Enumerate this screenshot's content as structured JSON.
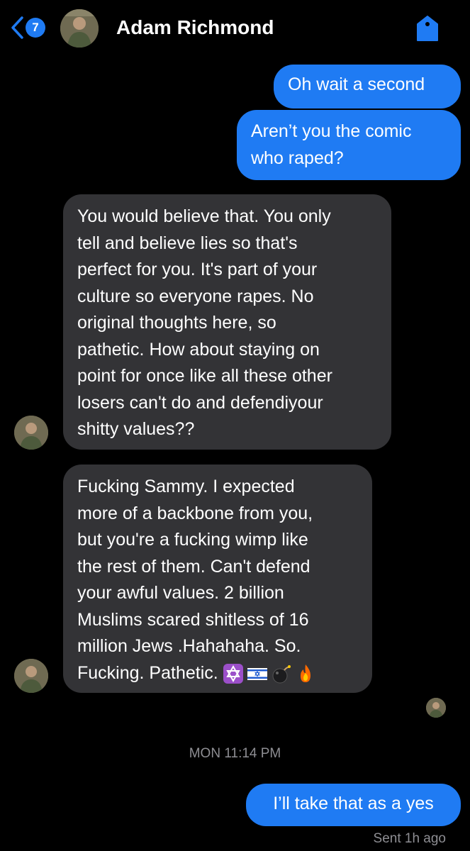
{
  "header": {
    "back_count": "7",
    "contact_name": "Adam Richmond",
    "back_icon": "chevron-left-icon",
    "tag_icon": "tag-icon",
    "accent": "#1f7bf3"
  },
  "messages": [
    {
      "direction": "outgoing",
      "lines": [
        "Oh wait a second"
      ]
    },
    {
      "direction": "outgoing",
      "lines": [
        "Aren’t you the comic",
        "who raped?"
      ]
    },
    {
      "direction": "incoming",
      "lines": [
        "You would believe that. You only",
        "tell and believe lies so that's",
        "perfect for you. It's part of your",
        "culture so everyone rapes. No",
        "original thoughts here, so",
        "pathetic. How about staying on",
        "point for once like all these other",
        "losers can't do and defendiyour",
        "shitty values??"
      ]
    },
    {
      "direction": "incoming",
      "lines": [
        "Fucking Sammy. I expected",
        "more of a backbone from you,",
        "but you're a fucking wimp like",
        "the rest of them. Can't defend",
        "your awful values. 2 billion",
        "Muslims scared shitless of 16",
        "million Jews .Hahahaha. So.",
        "Fucking. Pathetic."
      ],
      "emojis": [
        "star-of-david-emoji",
        "israel-flag-emoji",
        "bomb-emoji",
        "fire-emoji"
      ]
    },
    {
      "direction": "outgoing",
      "lines": [
        "I’ll take that as a yes"
      ]
    }
  ],
  "timestamp": "MON 11:14 PM",
  "sent_status": "Sent 1h ago",
  "colors": {
    "outgoing_bubble": "#1f7bf3",
    "incoming_bubble": "#333336",
    "meta_text": "#8e8e93"
  }
}
